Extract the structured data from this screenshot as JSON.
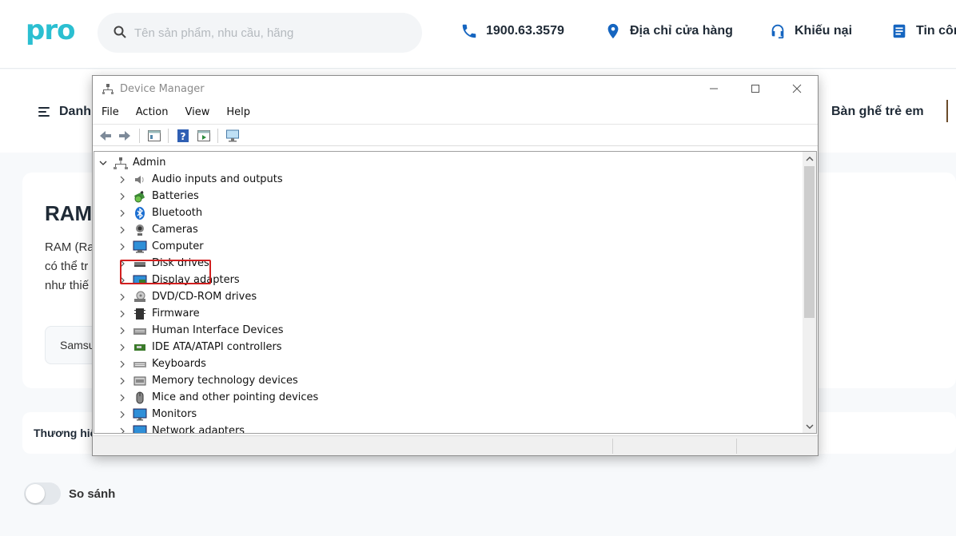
{
  "site": {
    "logo": "pro",
    "search_placeholder": "Tên sản phẩm, nhu cầu, hãng",
    "hotline": "1900.63.3579",
    "store_address": "Địa chỉ cửa hàng",
    "complaint": "Khiếu nại",
    "news": "Tin công",
    "menu_label": "Danh",
    "nav_right": "Bàn ghế trẻ em",
    "product_title": "RAM",
    "desc_lines": [
      "RAM (Ra",
      "có thể tr",
      "như thiế"
    ],
    "brand_chip": "Samsu",
    "filter_label": "Thương hiệ",
    "compare_label": "So sánh",
    "accent_color": "#2bbfd1"
  },
  "device_manager": {
    "title": "Device Manager",
    "window_controls": [
      "minimize",
      "maximize",
      "close"
    ],
    "menu": [
      "File",
      "Action",
      "View",
      "Help"
    ],
    "toolbar_icons": [
      "back-arrow-icon",
      "forward-arrow-icon",
      "properties-icon",
      "help-icon",
      "update-driver-icon",
      "scan-hardware-icon"
    ],
    "root": "Admin",
    "highlighted_item": "Batteries",
    "highlight_color": "#d11f1f",
    "categories": [
      {
        "label": "Audio inputs and outputs",
        "icon": "speaker-icon"
      },
      {
        "label": "Batteries",
        "icon": "battery-icon"
      },
      {
        "label": "Bluetooth",
        "icon": "bluetooth-icon"
      },
      {
        "label": "Cameras",
        "icon": "camera-icon"
      },
      {
        "label": "Computer",
        "icon": "computer-icon"
      },
      {
        "label": "Disk drives",
        "icon": "disk-drive-icon"
      },
      {
        "label": "Display adapters",
        "icon": "display-adapter-icon"
      },
      {
        "label": "DVD/CD-ROM drives",
        "icon": "dvd-drive-icon"
      },
      {
        "label": "Firmware",
        "icon": "firmware-icon"
      },
      {
        "label": "Human Interface Devices",
        "icon": "hid-icon"
      },
      {
        "label": "IDE ATA/ATAPI controllers",
        "icon": "ide-controller-icon"
      },
      {
        "label": "Keyboards",
        "icon": "keyboard-icon"
      },
      {
        "label": "Memory technology devices",
        "icon": "memory-device-icon"
      },
      {
        "label": "Mice and other pointing devices",
        "icon": "mouse-icon"
      },
      {
        "label": "Monitors",
        "icon": "monitor-icon"
      },
      {
        "label": "Network adapters",
        "icon": "network-adapter-icon"
      }
    ]
  }
}
